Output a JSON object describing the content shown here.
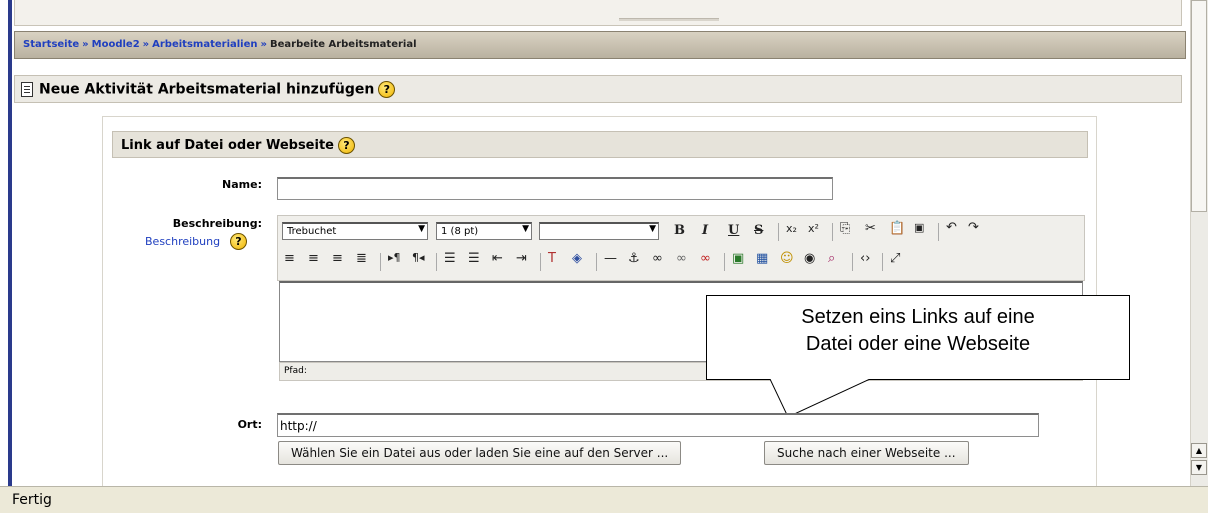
{
  "breadcrumb": {
    "items": [
      "Startseite",
      "Moodle2",
      "Arbeitsmaterialien"
    ],
    "separator": "»",
    "current": "Bearbeite Arbeitsmaterial"
  },
  "section": {
    "title": "Neue Aktivität Arbeitsmaterial hinzufügen",
    "icon": "document-icon"
  },
  "fieldset": {
    "title": "Link auf Datei oder Webseite"
  },
  "form": {
    "name_label": "Name:",
    "name_value": "",
    "description_label": "Beschreibung:",
    "description_help_link": "Beschreibung",
    "location_label": "Ort:",
    "location_value": "http://"
  },
  "editor": {
    "font_family": "Trebuchet",
    "font_size": "1 (8 pt)",
    "format": "",
    "path_label": "Pfad:"
  },
  "buttons": {
    "choose_file": "Wählen Sie ein Datei aus oder laden Sie eine auf den Server ...",
    "search_web": "Suche nach einer Webseite ..."
  },
  "callout": {
    "line1": "Setzen eins Links auf eine",
    "line2": "Datei oder eine Webseite"
  },
  "status": {
    "text": "Fertig"
  },
  "help_icon_glyph": "?"
}
